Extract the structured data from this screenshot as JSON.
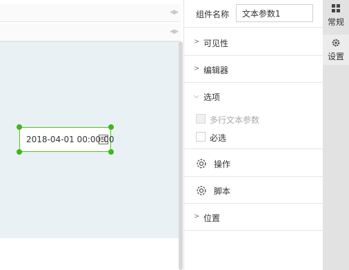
{
  "canvas": {
    "widget_value": "2018-04-01 00:00:00"
  },
  "properties": {
    "name_label": "组件名称",
    "name_value": "文本参数1",
    "sections": {
      "visibility": "可见性",
      "editor": "编辑器",
      "options": "选项",
      "actions": "操作",
      "script": "脚本",
      "position": "位置"
    },
    "options": {
      "multiline": "多行文本参数",
      "required": "必选"
    }
  },
  "rail": {
    "tabs": [
      {
        "label": "常规",
        "icon": "grid-icon"
      },
      {
        "label": "设置",
        "icon": "gear-icon"
      }
    ]
  },
  "colors": {
    "selection": "#3cb81b",
    "surface": "#eaf1f5"
  }
}
